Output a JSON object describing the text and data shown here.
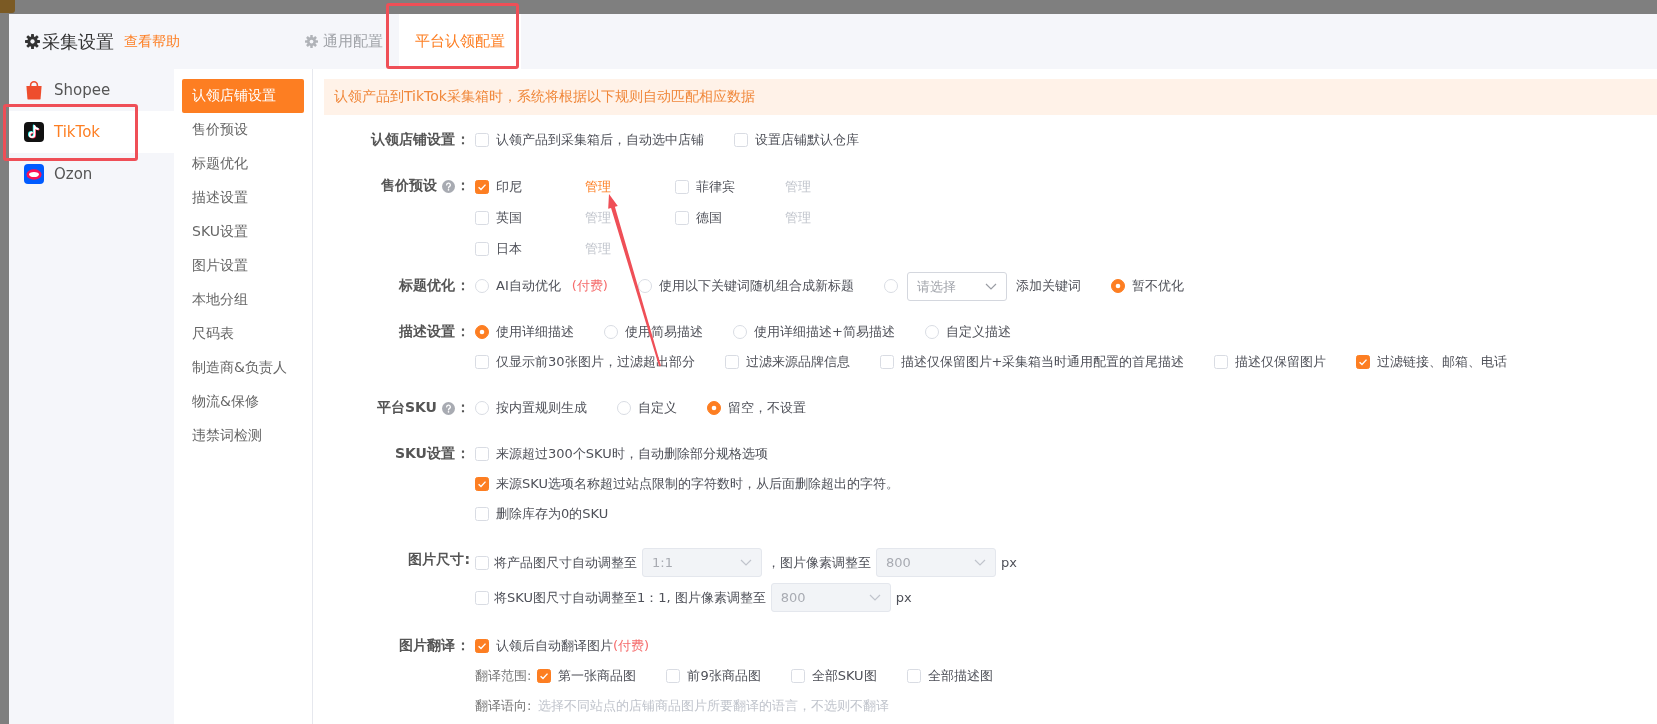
{
  "header": {
    "title": "采集设置",
    "help_link": "查看帮助",
    "tabs": [
      {
        "label": "通用配置",
        "has_icon": true,
        "selected": false
      },
      {
        "label": "平台认领配置",
        "has_icon": false,
        "selected": true
      }
    ]
  },
  "platforms": [
    {
      "name": "Shopee",
      "kind": "shopee",
      "selected": false
    },
    {
      "name": "TikTok",
      "kind": "tiktok",
      "selected": true
    },
    {
      "name": "Ozon",
      "kind": "ozon",
      "selected": false
    }
  ],
  "nav": [
    {
      "label": "认领店铺设置",
      "selected": true
    },
    {
      "label": "售价预设",
      "selected": false
    },
    {
      "label": "标题优化",
      "selected": false
    },
    {
      "label": "描述设置",
      "selected": false
    },
    {
      "label": "SKU设置",
      "selected": false
    },
    {
      "label": "图片设置",
      "selected": false
    },
    {
      "label": "本地分组",
      "selected": false
    },
    {
      "label": "尺码表",
      "selected": false
    },
    {
      "label": "制造商&负责人",
      "selected": false
    },
    {
      "label": "物流&保修",
      "selected": false
    },
    {
      "label": "违禁词检测",
      "selected": false
    }
  ],
  "notice": "认领产品到TikTok采集箱时，系统将根据以下规则自动匹配相应数据",
  "sections": [
    {
      "label": "认领店铺设置",
      "colon": "：",
      "help": false,
      "lines": [
        {
          "kind": "row",
          "items": [
            {
              "kind": "checkbox",
              "label": "认领产品到采集箱后，自动选中店铺",
              "checked": false
            },
            {
              "kind": "checkbox",
              "label": "设置店铺默认仓库",
              "checked": false
            }
          ]
        }
      ]
    },
    {
      "label": "售价预设",
      "colon": "：",
      "help": true,
      "lines": [
        {
          "kind": "grid",
          "items": [
            {
              "kind": "checkbox",
              "label": "印尼",
              "checked": true,
              "link": "管理"
            },
            {
              "kind": "checkbox",
              "label": "菲律宾",
              "checked": false,
              "link": "管理"
            }
          ]
        },
        {
          "kind": "grid",
          "items": [
            {
              "kind": "checkbox",
              "label": "英国",
              "checked": false,
              "link": "管理"
            },
            {
              "kind": "checkbox",
              "label": "德国",
              "checked": false,
              "link": "管理"
            }
          ]
        },
        {
          "kind": "grid",
          "items": [
            {
              "kind": "checkbox",
              "label": "日本",
              "checked": false,
              "link": "管理"
            }
          ]
        }
      ]
    },
    {
      "label": "标题优化",
      "colon": "：",
      "help": false,
      "lines": [
        {
          "kind": "row",
          "items": [
            {
              "kind": "radio",
              "label": "AI自动优化",
              "tag": "(付费)",
              "selected": false
            },
            {
              "kind": "radio",
              "label": "使用以下关键词随机组合成新标题",
              "selected": false
            },
            {
              "kind": "radio",
              "selected": false,
              "parts": [
                {
                  "kind": "select",
                  "placeholder": "请选择",
                  "disabled": false
                },
                {
                  "kind": "text",
                  "text": "添加关键词"
                }
              ]
            },
            {
              "kind": "radio",
              "label": "暂不优化",
              "selected": true
            }
          ]
        }
      ]
    },
    {
      "label": "描述设置",
      "colon": "：",
      "help": false,
      "lines": [
        {
          "kind": "row",
          "items": [
            {
              "kind": "radio",
              "label": "使用详细描述",
              "selected": true
            },
            {
              "kind": "radio",
              "label": "使用简易描述",
              "selected": false
            },
            {
              "kind": "radio",
              "label": "使用详细描述+简易描述",
              "selected": false
            },
            {
              "kind": "radio",
              "label": "自定义描述",
              "selected": false
            }
          ]
        },
        {
          "kind": "row",
          "items": [
            {
              "kind": "checkbox",
              "label": "仅显示前30张图片，过滤超出部分",
              "checked": false
            },
            {
              "kind": "checkbox",
              "label": "过滤来源品牌信息",
              "checked": false
            },
            {
              "kind": "checkbox",
              "label": "描述仅保留图片+采集箱当时通用配置的首尾描述",
              "checked": false
            },
            {
              "kind": "checkbox",
              "label": "描述仅保留图片",
              "checked": false
            },
            {
              "kind": "checkbox",
              "label": "过滤链接、邮箱、电话",
              "checked": true
            }
          ]
        }
      ]
    },
    {
      "label": "平台SKU",
      "colon": "：",
      "help": true,
      "lines": [
        {
          "kind": "row",
          "items": [
            {
              "kind": "radio",
              "label": "按内置规则生成",
              "selected": false
            },
            {
              "kind": "radio",
              "label": "自定义",
              "selected": false
            },
            {
              "kind": "radio",
              "label": "留空，不设置",
              "selected": true
            }
          ]
        }
      ]
    },
    {
      "label": "SKU设置",
      "colon": "：",
      "help": false,
      "lines": [
        {
          "kind": "row",
          "items": [
            {
              "kind": "checkbox",
              "label": "来源超过300个SKU时，自动删除部分规格选项",
              "checked": false
            }
          ]
        },
        {
          "kind": "row",
          "items": [
            {
              "kind": "checkbox",
              "label": "来源SKU选项名称超过站点限制的字符数时，从后面删除超出的字符。",
              "checked": true
            }
          ]
        },
        {
          "kind": "row",
          "items": [
            {
              "kind": "checkbox",
              "label": "删除库存为0的SKU",
              "checked": false
            }
          ]
        }
      ]
    },
    {
      "label": "图片尺寸:",
      "help": false,
      "lines": [
        {
          "kind": "row",
          "items": [
            {
              "kind": "checkbox",
              "checked": false,
              "parts": [
                {
                  "kind": "text",
                  "text": "将产品图尺寸自动调整至"
                },
                {
                  "kind": "select",
                  "value": "1:1",
                  "disabled": true
                },
                {
                  "kind": "text",
                  "text": "，图片像素调整至"
                },
                {
                  "kind": "select",
                  "value": "800",
                  "disabled": true
                },
                {
                  "kind": "text",
                  "text": "px"
                }
              ]
            }
          ]
        },
        {
          "kind": "row",
          "items": [
            {
              "kind": "checkbox",
              "checked": false,
              "parts": [
                {
                  "kind": "text",
                  "text": "将SKU图尺寸自动调整至1：1, 图片像素调整至"
                },
                {
                  "kind": "select",
                  "value": "800",
                  "disabled": true
                },
                {
                  "kind": "text",
                  "text": "px"
                }
              ]
            }
          ]
        }
      ]
    },
    {
      "label": "图片翻译",
      "colon": "：",
      "help": false,
      "lines": [
        {
          "kind": "row",
          "items": [
            {
              "kind": "checkbox",
              "label": "认领后自动翻译图片",
              "tag": "(付费)",
              "checked": true
            }
          ]
        },
        {
          "kind": "row",
          "caption": "翻译范围:",
          "items": [
            {
              "kind": "checkbox",
              "label": "第一张商品图",
              "checked": true
            },
            {
              "kind": "checkbox",
              "label": "前9张商品图",
              "checked": false
            },
            {
              "kind": "checkbox",
              "label": "全部SKU图",
              "checked": false
            },
            {
              "kind": "checkbox",
              "label": "全部描述图",
              "checked": false
            }
          ]
        },
        {
          "kind": "row",
          "caption": "翻译语向:",
          "hint": "选择不同站点的店铺商品图片所要翻译的语言，不选则不翻译"
        }
      ]
    }
  ]
}
